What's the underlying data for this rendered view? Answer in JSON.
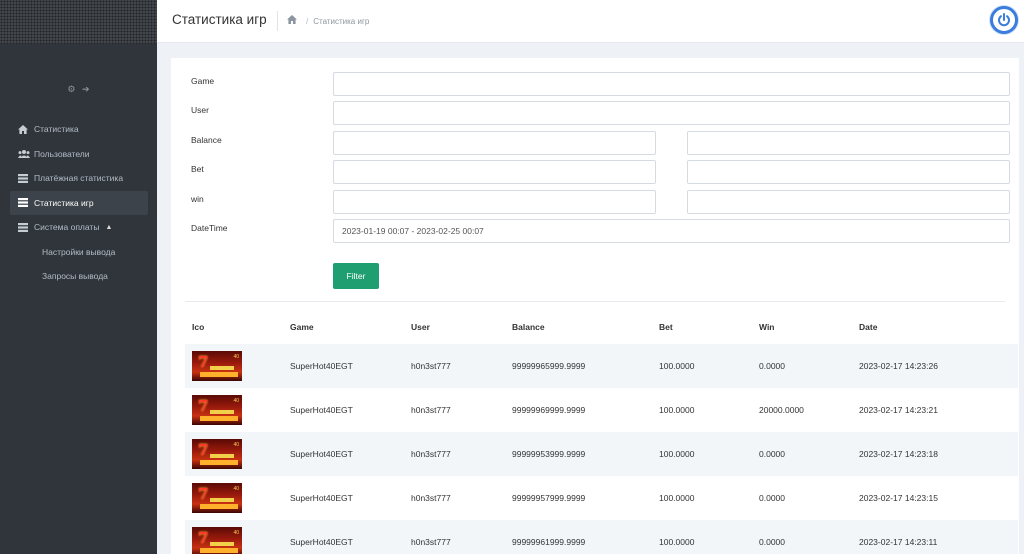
{
  "header": {
    "title": "Статистика игр",
    "breadcrumb": "Статистика игр"
  },
  "sidebar": {
    "tools": {
      "settings_icon": "gear-icon",
      "logout_icon": "sign-out-icon"
    },
    "items": [
      {
        "label": "Статистика",
        "icon": "home-icon"
      },
      {
        "label": "Пользователи",
        "icon": "users-icon"
      },
      {
        "label": "Платёжная статистика",
        "icon": "list-icon"
      },
      {
        "label": "Статистика игр",
        "icon": "list-icon"
      },
      {
        "label": "Система оплаты",
        "icon": "list-icon"
      }
    ],
    "subitems": [
      {
        "label": "Настройки вывода"
      },
      {
        "label": "Запросы вывода"
      }
    ]
  },
  "filters": {
    "game_label": "Game",
    "user_label": "User",
    "balance_label": "Balance",
    "bet_label": "Bet",
    "win_label": "win",
    "datetime_label": "DateTime",
    "datetime_value": "2023-01-19 00:07 - 2023-02-25 00:07",
    "filter_button": "Filter"
  },
  "table": {
    "headers": [
      "Ico",
      "Game",
      "User",
      "Balance",
      "Bet",
      "Win",
      "Date"
    ],
    "rows": [
      {
        "game": "SuperHot40EGT",
        "user": "h0n3st777",
        "balance": "99999965999.9999",
        "bet": "100.0000",
        "win": "0.0000",
        "date": "2023-02-17 14:23:26"
      },
      {
        "game": "SuperHot40EGT",
        "user": "h0n3st777",
        "balance": "99999969999.9999",
        "bet": "100.0000",
        "win": "20000.0000",
        "date": "2023-02-17 14:23:21"
      },
      {
        "game": "SuperHot40EGT",
        "user": "h0n3st777",
        "balance": "99999953999.9999",
        "bet": "100.0000",
        "win": "0.0000",
        "date": "2023-02-17 14:23:18"
      },
      {
        "game": "SuperHot40EGT",
        "user": "h0n3st777",
        "balance": "99999957999.9999",
        "bet": "100.0000",
        "win": "0.0000",
        "date": "2023-02-17 14:23:15"
      },
      {
        "game": "SuperHot40EGT",
        "user": "h0n3st777",
        "balance": "99999961999.9999",
        "bet": "100.0000",
        "win": "0.0000",
        "date": "2023-02-17 14:23:11"
      }
    ]
  },
  "colors": {
    "sidebar_bg": "#2f353b",
    "accent_green": "#1f9e71",
    "power_blue": "#3b7ddd"
  }
}
